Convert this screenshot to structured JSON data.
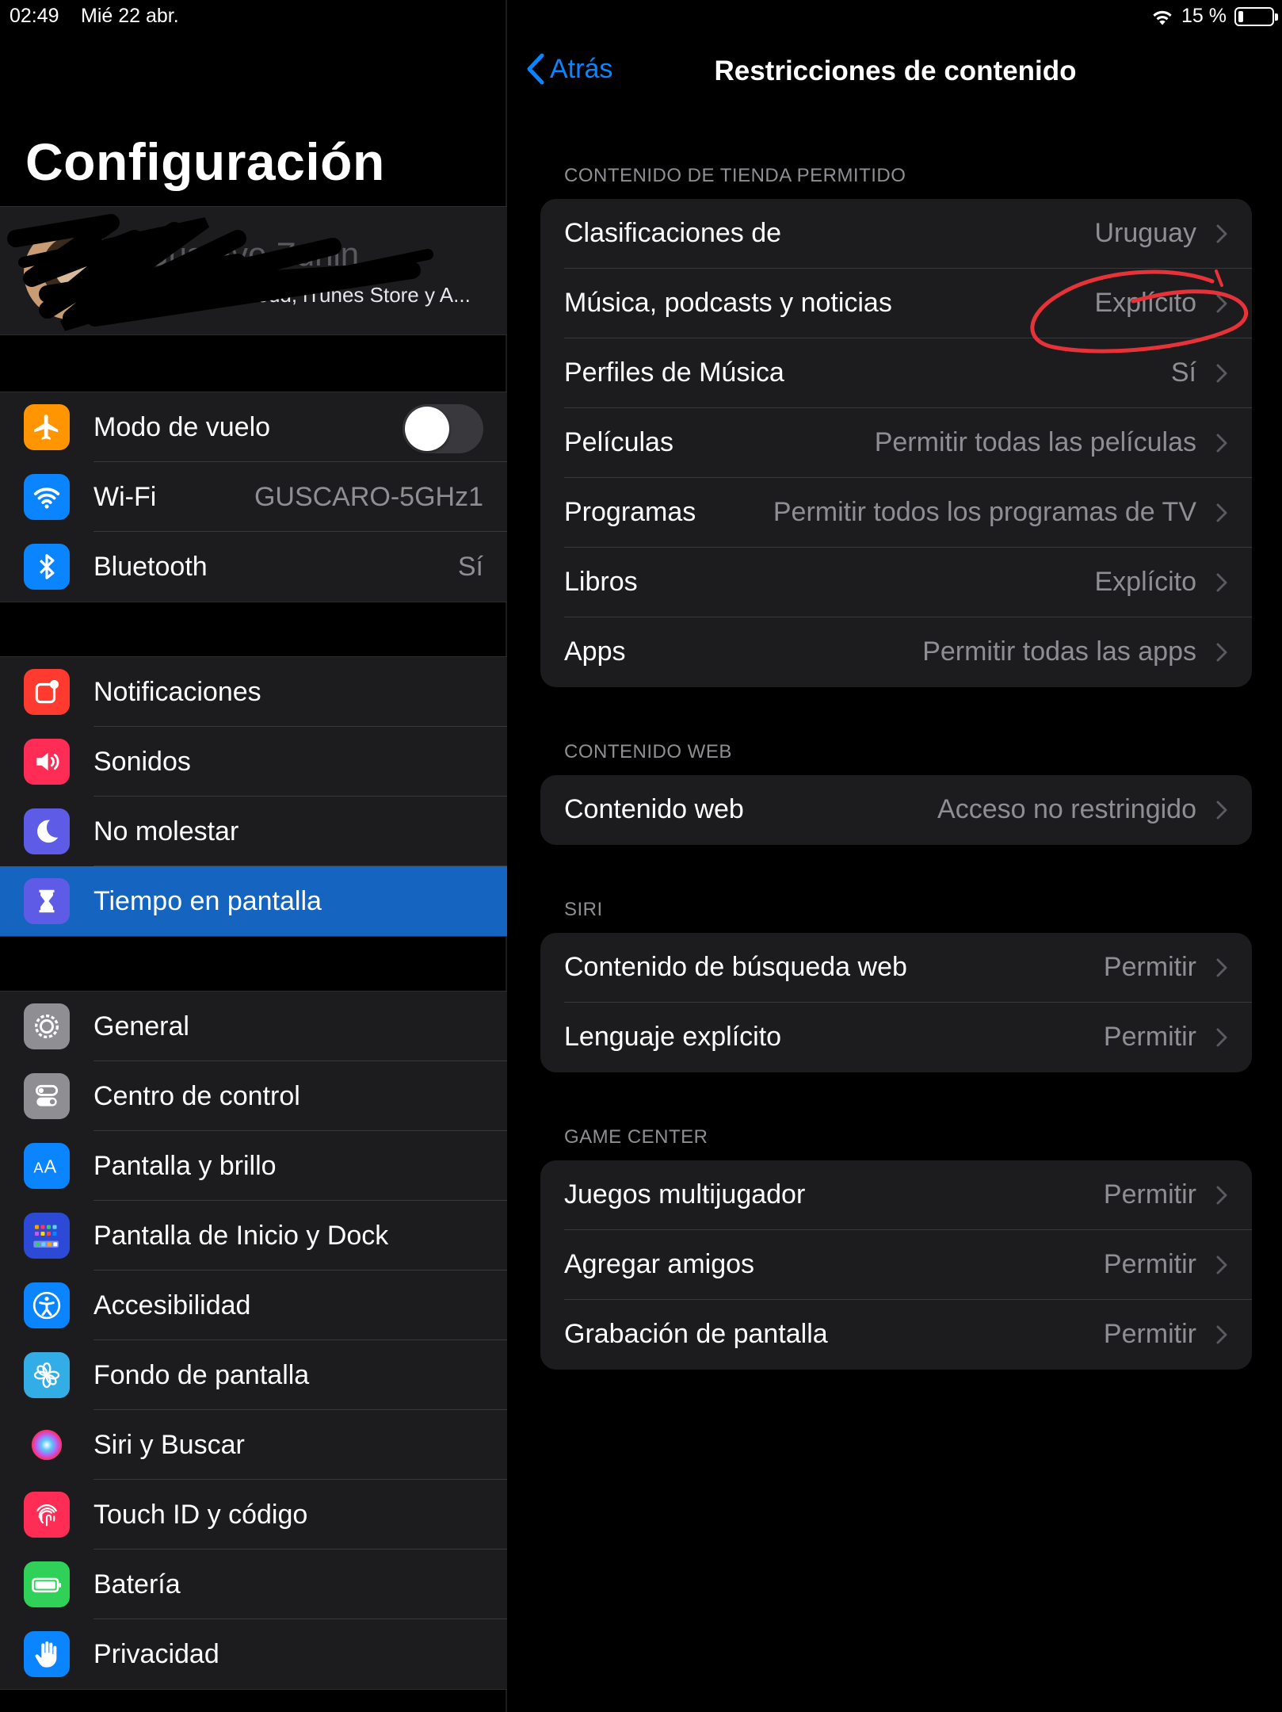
{
  "status_bar": {
    "time": "02:49",
    "date": "Mié 22 abr.",
    "battery_text": "15 %",
    "battery_level": 0.15
  },
  "sidebar": {
    "title": "Configuración",
    "profile": {
      "name": "Gustavo Zunin",
      "subtitle": "Apple ID, iCloud, iTunes Store y A..."
    },
    "group1": [
      {
        "label": "Modo de vuelo",
        "icon": "airplane-icon",
        "color": "#ff9500",
        "toggle": false
      },
      {
        "label": "Wi-Fi",
        "value": "GUSCARO-5GHz1",
        "icon": "wifi-icon",
        "color": "#0a84ff"
      },
      {
        "label": "Bluetooth",
        "value": "Sí",
        "icon": "bluetooth-icon",
        "color": "#0a84ff"
      }
    ],
    "group2": [
      {
        "label": "Notificaciones",
        "icon": "notifications-icon",
        "color": "#ff3b30"
      },
      {
        "label": "Sonidos",
        "icon": "speaker-icon",
        "color": "#ff2d55"
      },
      {
        "label": "No molestar",
        "icon": "moon-icon",
        "color": "#5e5ce6"
      },
      {
        "label": "Tiempo en pantalla",
        "icon": "hourglass-icon",
        "color": "#5e5ce6",
        "selected": true
      }
    ],
    "group3": [
      {
        "label": "General",
        "icon": "gear-icon",
        "color": "#8e8e93"
      },
      {
        "label": "Centro de control",
        "icon": "switches-icon",
        "color": "#8e8e93"
      },
      {
        "label": "Pantalla y brillo",
        "icon": "text-size-icon",
        "color": "#0a84ff"
      },
      {
        "label": "Pantalla de Inicio y Dock",
        "icon": "home-grid-icon",
        "color": "#2c4ad6"
      },
      {
        "label": "Accesibilidad",
        "icon": "accessibility-icon",
        "color": "#0a84ff"
      },
      {
        "label": "Fondo de pantalla",
        "icon": "flower-icon",
        "color": "#32ade6"
      },
      {
        "label": "Siri y Buscar",
        "icon": "siri-icon",
        "color": "#1c1c1e"
      },
      {
        "label": "Touch ID y código",
        "icon": "fingerprint-icon",
        "color": "#ff2d55"
      },
      {
        "label": "Batería",
        "icon": "battery-icon",
        "color": "#30d158"
      },
      {
        "label": "Privacidad",
        "icon": "hand-icon",
        "color": "#0a84ff"
      }
    ]
  },
  "detail": {
    "back_label": "Atrás",
    "title": "Restricciones de contenido",
    "sections": [
      {
        "header": "CONTENIDO DE TIENDA PERMITIDO",
        "rows": [
          {
            "label": "Clasificaciones de",
            "value": "Uruguay"
          },
          {
            "label": "Música, podcasts y noticias",
            "value": "Explícito"
          },
          {
            "label": "Perfiles de Música",
            "value": "Sí"
          },
          {
            "label": "Películas",
            "value": "Permitir todas las películas"
          },
          {
            "label": "Programas",
            "value": "Permitir todos los programas de TV"
          },
          {
            "label": "Libros",
            "value": "Explícito"
          },
          {
            "label": "Apps",
            "value": "Permitir todas las apps"
          }
        ]
      },
      {
        "header": "CONTENIDO WEB",
        "rows": [
          {
            "label": "Contenido web",
            "value": "Acceso no restringido"
          }
        ]
      },
      {
        "header": "SIRI",
        "rows": [
          {
            "label": "Contenido de búsqueda web",
            "value": "Permitir"
          },
          {
            "label": "Lenguaje explícito",
            "value": "Permitir"
          }
        ]
      },
      {
        "header": "GAME CENTER",
        "rows": [
          {
            "label": "Juegos multijugador",
            "value": "Permitir"
          },
          {
            "label": "Agregar amigos",
            "value": "Permitir"
          },
          {
            "label": "Grabación de pantalla",
            "value": "Permitir"
          }
        ]
      }
    ]
  }
}
